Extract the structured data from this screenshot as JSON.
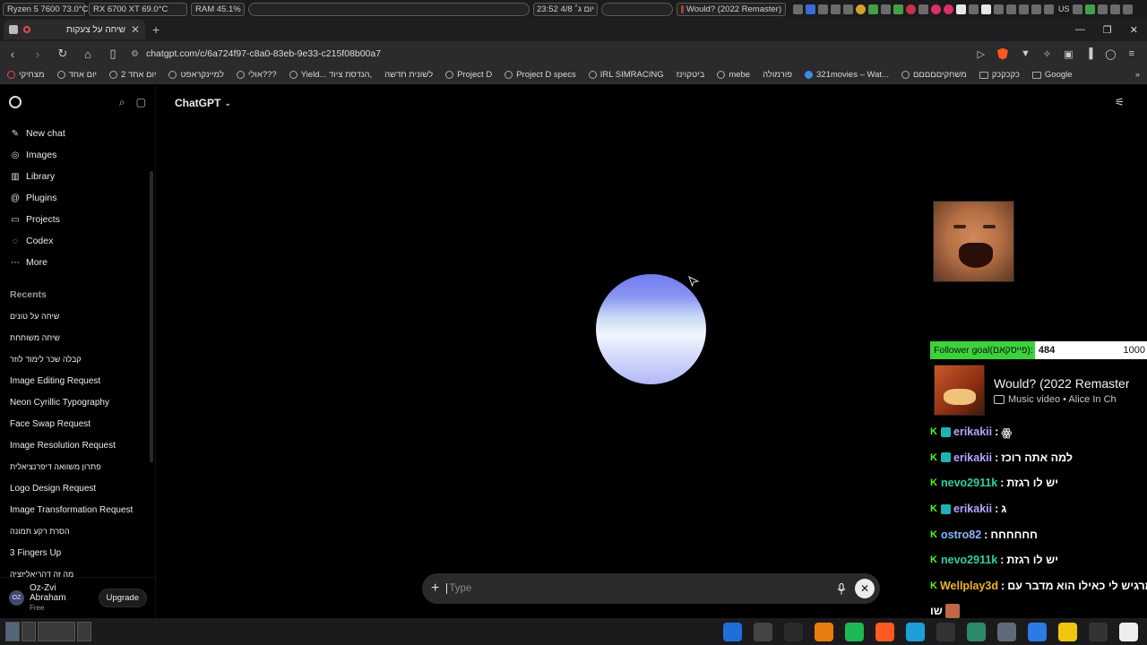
{
  "system_bar": {
    "cpu": "Ryzen 5 7600  73.0°C",
    "gpu": "RX 6700 XT 69.0°C",
    "ram": "RAM   45.1%",
    "clock": "23:52 יום ג׳ 4/8",
    "media": "Would? (2022 Remaster)",
    "keyboard": "US"
  },
  "browser": {
    "tab_title": "שיחה על צעקות",
    "url": "chatgpt.com/c/6a724f97-c8a0-83eb-9e33-c215f08b00a7",
    "bookmarks": [
      "מצחיקי",
      "יום אחד",
      "יום אחד 2",
      "למיינקראפט",
      "אולי???",
      "Yield... הנדסת ציוד,",
      "לשונית חדשה",
      "Project D",
      "Project D specs",
      "IRL SIMRACING",
      "ביטקוינז",
      "mebe",
      "פורמולה",
      "321movies – Wat...",
      "משחקיםםםםם",
      "כקכקכק",
      "Google"
    ]
  },
  "sidebar": {
    "nav": [
      {
        "label": "New chat",
        "icon": "compose-icon",
        "glyph": "✎"
      },
      {
        "label": "Images",
        "icon": "images-icon",
        "glyph": "◎"
      },
      {
        "label": "Library",
        "icon": "library-icon",
        "glyph": "▥"
      },
      {
        "label": "Plugins",
        "icon": "plugins-icon",
        "glyph": "@"
      },
      {
        "label": "Projects",
        "icon": "folder-icon",
        "glyph": "▭"
      },
      {
        "label": "Codex",
        "icon": "codex-icon",
        "glyph": "◌"
      },
      {
        "label": "More",
        "icon": "more-icon",
        "glyph": "⋯"
      }
    ],
    "recents_heading": "Recents",
    "recents": [
      "שיחה על טונים",
      "שיחה משוחחת",
      "קבלה שכר לימוד לוזר",
      "Image Editing Request",
      "Neon Cyrillic Typography",
      "Face Swap Request",
      "Image Resolution Request",
      "פתרון משוואה דיפרנציאלית",
      "Logo Design Request",
      "Image Transformation Request",
      "הסרת רקע תמונה",
      "3 Fingers Up",
      "מה זה דהריאליזציה"
    ],
    "user": {
      "initials": "OZ",
      "name": "Oz-Zvi Abraham",
      "plan": "Free",
      "upgrade_label": "Upgrade"
    }
  },
  "main": {
    "model_label": "ChatGPT",
    "composer_placeholder": "Type"
  },
  "overlay": {
    "follower_goal": {
      "label": "Follower goal(פייסקאם):",
      "current": "484",
      "target": "1000",
      "progress": 0.484
    },
    "now_playing": {
      "title": "Would? (2022 Remaster",
      "subtitle": "Music video  •  Alice In Ch"
    },
    "chat": [
      {
        "user": "erikakii",
        "color": "#b7a4ff",
        "text": "ꙮ",
        "badge2": true
      },
      {
        "user": "erikakii",
        "color": "#b7a4ff",
        "text": "למה אתה רוכז",
        "badge2": true
      },
      {
        "user": "nevo2911k",
        "color": "#2ecfa0",
        "text": "יש לו רגזת",
        "badge2": false
      },
      {
        "user": "erikakii",
        "color": "#b7a4ff",
        "text": "ג",
        "badge2": true
      },
      {
        "user": "ostro82",
        "color": "#8ab4f8",
        "text": "חחחחחח",
        "badge2": false
      },
      {
        "user": "nevo2911k",
        "color": "#2ecfa0",
        "text": "יש לו רגזת",
        "badge2": false
      },
      {
        "user": "Wellplay3d",
        "color": "#f0b429",
        "text": "מרגיש לי כאילו הוא מדבר עם",
        "badge2": false
      },
      {
        "user": "",
        "color": "#ffffff",
        "text": "שו",
        "badge2": false,
        "emote_only": true
      }
    ]
  },
  "taskbar": {
    "apps": [
      {
        "name": "windows-icon",
        "color": "#1e6fd9"
      },
      {
        "name": "discord-icon",
        "color": "#444"
      },
      {
        "name": "steam-icon",
        "color": "#2a2a2a"
      },
      {
        "name": "blender-icon",
        "color": "#e87d0d"
      },
      {
        "name": "spotify-icon",
        "color": "#1db954"
      },
      {
        "name": "brave-icon",
        "color": "#ff5a1f"
      },
      {
        "name": "edge-icon",
        "color": "#1c9fd9"
      },
      {
        "name": "epic-icon",
        "color": "#333"
      },
      {
        "name": "layers-icon",
        "color": "#2c8a6a"
      },
      {
        "name": "files-icon",
        "color": "#5f6b7a"
      },
      {
        "name": "store-icon",
        "color": "#2c7be5"
      },
      {
        "name": "sun-icon",
        "color": "#f1c40f"
      },
      {
        "name": "terminal-icon",
        "color": "#333"
      },
      {
        "name": "kick-icon",
        "color": "#eee"
      }
    ]
  }
}
